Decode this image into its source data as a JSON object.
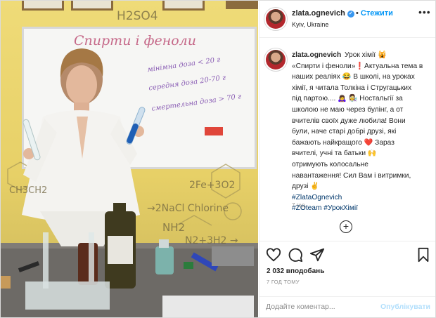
{
  "post": {
    "username": "zlata.ognevich",
    "follow_label": "Стежити",
    "location": "Kyiv, Ukraine",
    "more_label": "•••",
    "caption_lines": [
      "Урок хімії 🙀",
      "«Спирти і феноли»❗Актуальна тема в",
      "наших реаліях 😂 В школі, на уроках",
      "хімії, я читала Толкіна і Стругацьких",
      "під партою.... 🙇‍♀️ 👩‍🔬 Ностальгії за",
      "школою не маю через булінг, а от",
      "вчителів своїх дуже любила! Вони",
      "були, наче старі добрі друзі, які",
      "бажають найкращого ❤️ Зараз",
      "вчителі, учні та батьки 🙌",
      "отримують колосальне",
      "навантаження! Сил Вам і витримки,",
      "друзі ✌️"
    ],
    "hashtags": [
      "#ZlataOgnevich",
      "#ZOteam #УрокХімії"
    ],
    "time_short": "7 год.",
    "likes": "2 032 вподобань",
    "time_long": "7 ГОД ТОМУ",
    "comment_placeholder": "Додайте коментар...",
    "publish_label": "Опублікувати"
  },
  "photo": {
    "board_title": "Спирти і феноли",
    "board_lines": [
      "мінімна доза < 20 г",
      "середня доза 20-70 г",
      "смертельна доза > 70 г"
    ],
    "wall": {
      "h2so4": "H2SO4",
      "ch3ch2": "CH3CH2",
      "fe": "2Fe+3O2",
      "nacl": "→2NaCl Chlorine",
      "nh2": "NH2",
      "n2": "N2+3H2 →"
    }
  },
  "colors": {
    "link": "#00376b",
    "accent": "#0095f6",
    "muted": "#8e8e8e"
  }
}
